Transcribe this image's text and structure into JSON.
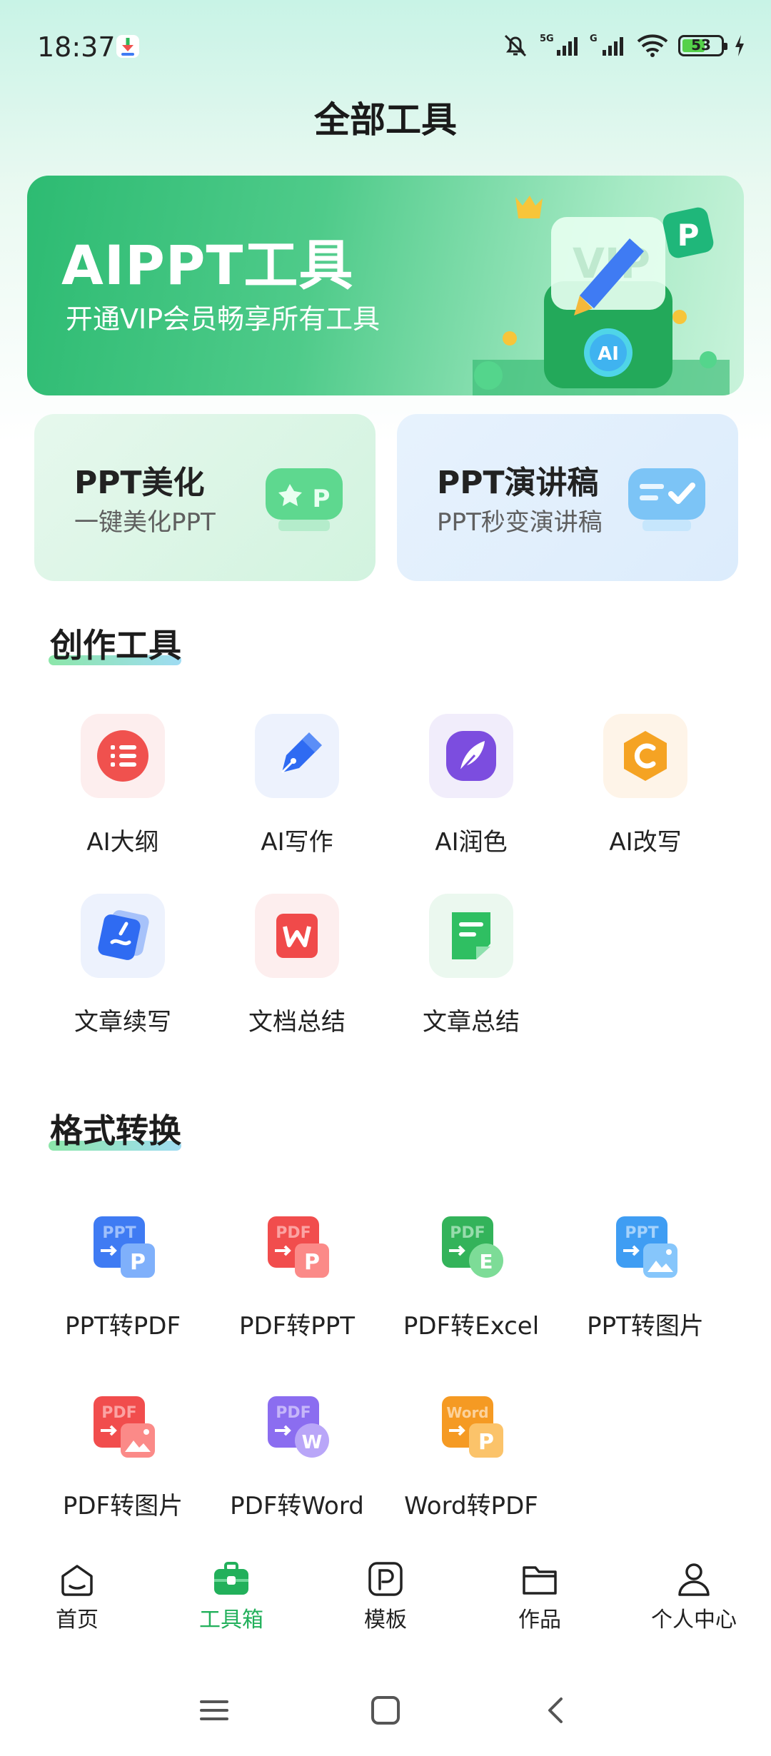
{
  "status": {
    "time": "18:37",
    "battery": "53",
    "battery_level_percent": 53
  },
  "title": "全部工具",
  "banner": {
    "title": "AIPPT工具",
    "subtitle": "开通VIP会员畅享所有工具",
    "art_badge_text": "AI",
    "art_p_text": "P"
  },
  "cards": [
    {
      "title": "PPT美化",
      "subtitle": "一键美化PPT"
    },
    {
      "title": "PPT演讲稿",
      "subtitle": "PPT秒变演讲稿"
    }
  ],
  "sections": {
    "creation": {
      "title": "创作工具",
      "items": [
        {
          "label": "AI大纲",
          "icon": "outline-icon",
          "color": "#f0514e"
        },
        {
          "label": "AI写作",
          "icon": "pen-icon",
          "color": "#2f6bf2"
        },
        {
          "label": "AI润色",
          "icon": "feather-icon",
          "color": "#7c4ddf"
        },
        {
          "label": "AI改写",
          "icon": "rewrite-icon",
          "color": "#f5a323"
        },
        {
          "label": "文章续写",
          "icon": "continue-writing-icon",
          "color": "#2f6bf2"
        },
        {
          "label": "文档总结",
          "icon": "word-summary-icon",
          "color": "#f04a4a"
        },
        {
          "label": "文章总结",
          "icon": "article-summary-icon",
          "color": "#2fbf62"
        }
      ]
    },
    "convert": {
      "title": "格式转换",
      "items": [
        {
          "label": "PPT转PDF",
          "src": "PPT",
          "dst": "P",
          "color": "#3f7bf3",
          "color2": "#7fb0fb"
        },
        {
          "label": "PDF转PPT",
          "src": "PDF",
          "dst": "P",
          "color": "#f14d4d",
          "color2": "#fb8a88"
        },
        {
          "label": "PDF转Excel",
          "src": "PDF",
          "dst": "E",
          "color": "#33b35a",
          "color2": "#7ddc97"
        },
        {
          "label": "PPT转图片",
          "src": "PPT",
          "dst": "img",
          "color": "#3f9df3",
          "color2": "#86c6fb"
        },
        {
          "label": "PDF转图片",
          "src": "PDF",
          "dst": "img",
          "color": "#f14d4d",
          "color2": "#fb8a88"
        },
        {
          "label": "PDF转Word",
          "src": "PDF",
          "dst": "W",
          "color": "#8b6df0",
          "color2": "#b9a6f8"
        },
        {
          "label": "Word转PDF",
          "src": "Word",
          "dst": "P",
          "color": "#f59a23",
          "color2": "#fbc36a"
        }
      ]
    }
  },
  "nav": {
    "items": [
      {
        "label": "首页",
        "icon": "home-icon"
      },
      {
        "label": "工具箱",
        "icon": "toolbox-icon",
        "active": true
      },
      {
        "label": "模板",
        "icon": "template-icon"
      },
      {
        "label": "作品",
        "icon": "folder-icon"
      },
      {
        "label": "个人中心",
        "icon": "person-icon"
      }
    ],
    "accent": "#22b05b"
  }
}
